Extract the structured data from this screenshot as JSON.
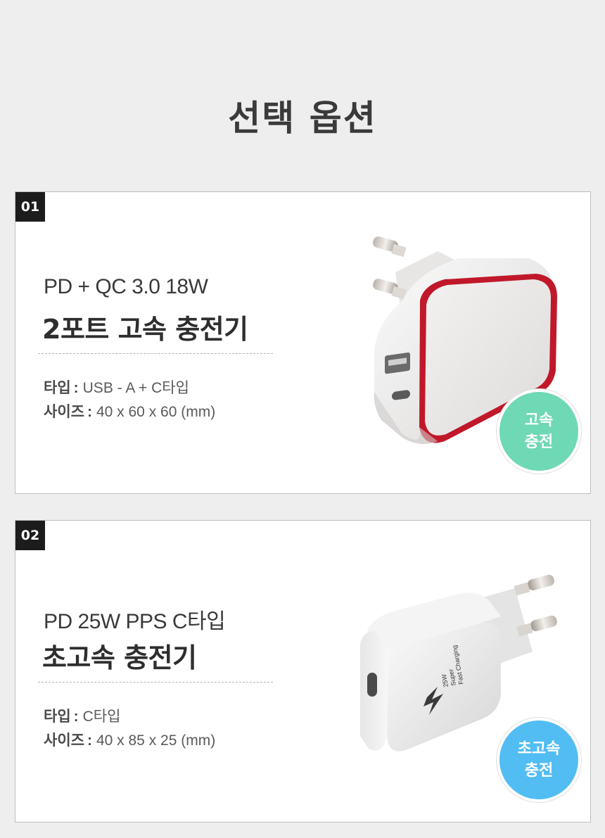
{
  "page": {
    "title": "선택 옵션"
  },
  "options": [
    {
      "number": "01",
      "subtitle": "PD + QC 3.0 18W",
      "title": "2포트 고속 충전기",
      "specs": [
        {
          "key": "타입",
          "sep": ":",
          "value": "USB - A + C타입"
        },
        {
          "key": "사이즈",
          "sep": ":",
          "value": "40 x 60 x 60 (mm)"
        }
      ],
      "badge": {
        "line1": "고속",
        "line2": "충전",
        "color": "#6fd8b5"
      },
      "image": {
        "accent": "#c0182a",
        "body": "#f1efee"
      }
    },
    {
      "number": "02",
      "subtitle": "PD 25W PPS C타입",
      "title": "초고속 충전기",
      "specs": [
        {
          "key": "타입",
          "sep": ":",
          "value": "C타입"
        },
        {
          "key": "사이즈",
          "sep": ":",
          "value": "40 x 85 x 25 (mm)"
        }
      ],
      "badge": {
        "line1": "초고속",
        "line2": "충전",
        "color": "#52bdf2"
      },
      "image": {
        "body": "#f2f2f2",
        "print_line1": "25W",
        "print_line2": "Super",
        "print_line3": "Fast Charging"
      }
    }
  ]
}
